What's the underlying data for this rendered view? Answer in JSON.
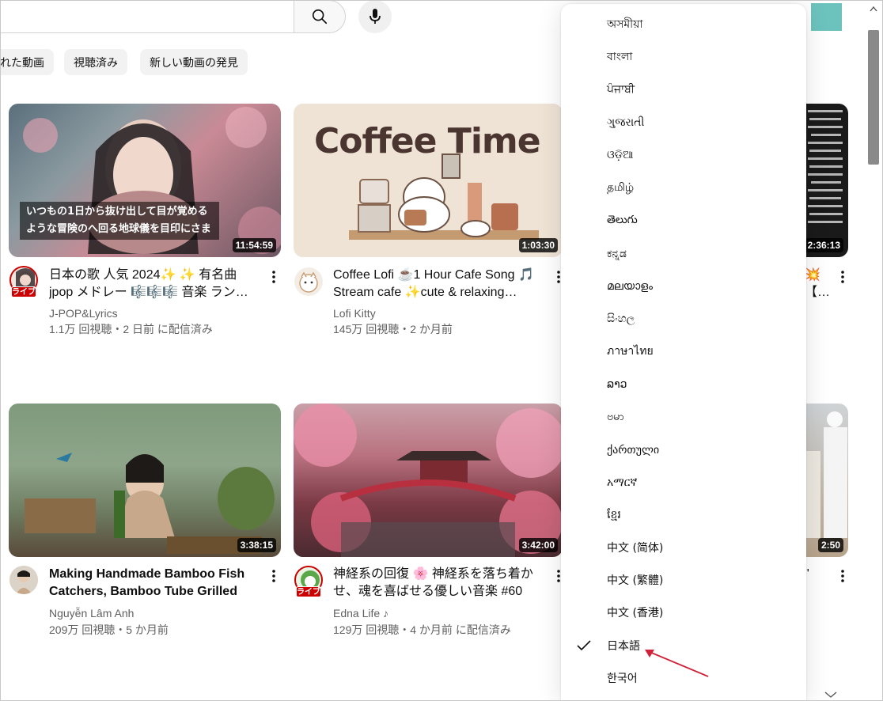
{
  "chips": [
    "れた動画",
    "視聴済み",
    "新しい動画の発見"
  ],
  "videos": [
    {
      "title": "日本の歌 人気 2024✨ ✨ 有名曲 jpop メドレー 🎼🎼🎼 音楽 ラン…",
      "channel": "J-POP&Lyrics",
      "meta": "1.1万 回視聴・2 日前 に配信済み",
      "duration": "11:54:59",
      "live": "ライブ",
      "overlay": "いつもの1日から抜け出して目が覚める ような冒険のへ回る地球儀を目印にさま"
    },
    {
      "title": "Coffee Lofi ☕1 Hour Cafe Song 🎵 Stream cafe ✨cute & relaxing…",
      "channel": "Lofi Kitty",
      "meta": "145万 回視聴・2 か月前",
      "duration": "1:03:30",
      "thumb_text": "Coffee Time"
    },
    {
      "title": "💥 【…",
      "duration": "2:36:13"
    },
    {
      "title": "Making Handmade Bamboo Fish Catchers, Bamboo Tube Grilled Fis…",
      "channel": "Nguyễn Lâm Anh",
      "meta": "209万 回視聴・5 か月前",
      "duration": "3:38:15"
    },
    {
      "title": "神経系の回復 🌸 神経系を落ち着かせ、魂を喜ばせる優しい音楽 #60",
      "channel": "Edna Life ♪",
      "meta": "129万 回視聴・4 か月前 に配信済み",
      "duration": "3:42:00",
      "live": "ライブ"
    },
    {
      "title": "\"",
      "duration": "2:50"
    }
  ],
  "language_menu": {
    "items": [
      "অসমীয়া",
      "বাংলা",
      "ਪੰਜਾਬੀ",
      "ગુજરાતી",
      "ଓଡ଼ିଆ",
      "தமிழ்",
      "తెలుగు",
      "ಕನ್ನಡ",
      "മലയാളം",
      "සිංහල",
      "ภาษาไทย",
      "ລາວ",
      "ဗမာ",
      "ქართული",
      "አማርኛ",
      "ខ្មែរ",
      "中文 (简体)",
      "中文 (繁體)",
      "中文 (香港)",
      "日本語",
      "한국어"
    ],
    "selected": "日本語"
  },
  "colors": {
    "accent_arrow": "#d0223a",
    "live_badge": "#cc0000",
    "avatar": "#6cc3bd"
  }
}
